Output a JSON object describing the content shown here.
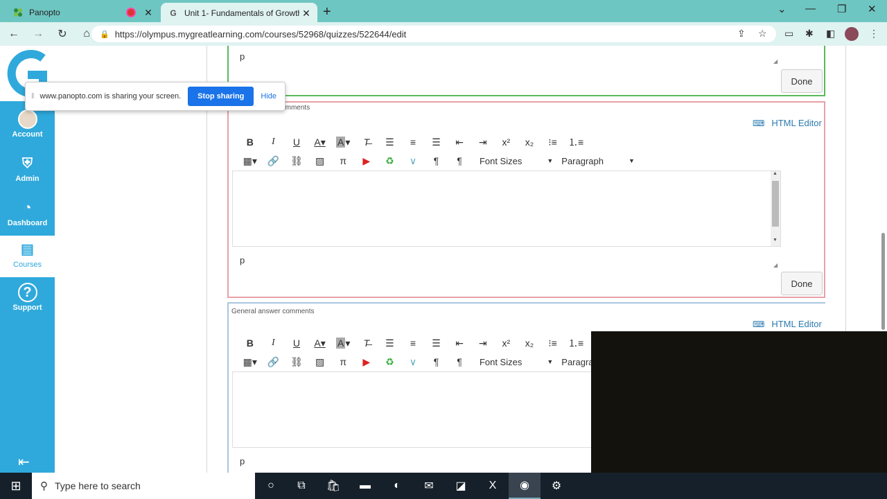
{
  "browser": {
    "tabs": [
      {
        "title": "Panopto",
        "close": "✕"
      },
      {
        "title": "Unit 1- Fundamentals of Growth",
        "close": "✕"
      }
    ],
    "new_tab": "+",
    "url": "https://olympus.mygreatlearning.com/courses/52968/quizzes/522644/edit"
  },
  "share_bar": {
    "text": "www.panopto.com is sharing your screen.",
    "stop_label": "Stop sharing",
    "hide_label": "Hide"
  },
  "sidebar": {
    "items": [
      {
        "label": "Account",
        "icon": "avatar"
      },
      {
        "label": "Admin",
        "icon": "shield-star-icon"
      },
      {
        "label": "Dashboard",
        "icon": "gauge-icon"
      },
      {
        "label": "Courses",
        "icon": "notebook-icon",
        "active": true
      },
      {
        "label": "Support",
        "icon": "question-icon"
      }
    ]
  },
  "editor1": {
    "path_label": "p",
    "done_label": "Done"
  },
  "editor2": {
    "title": "Wrong answer comments",
    "html_editor_label": "HTML Editor",
    "font_sizes_label": "Font Sizes",
    "paragraph_label": "Paragraph",
    "path_label": "p",
    "done_label": "Done"
  },
  "editor3": {
    "title": "General answer comments",
    "html_editor_label": "HTML Editor",
    "font_sizes_label": "Font Sizes",
    "paragraph_label": "Paragra",
    "path_label": "p"
  },
  "taskbar": {
    "search_placeholder": "Type here to search"
  },
  "colors": {
    "brand": "#2fa9dc",
    "chrome": "#6ec6c2",
    "wrong_border": "#e8a0a8",
    "correct_border": "#5cb85c"
  }
}
